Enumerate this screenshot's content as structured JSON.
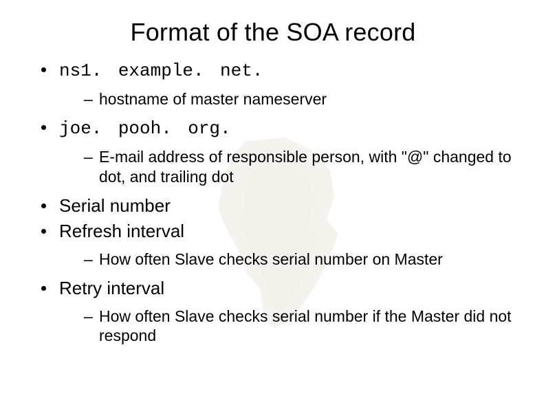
{
  "title": "Format of the SOA record",
  "items": [
    {
      "text": "ns1. example. net.",
      "mono": true,
      "sub": "hostname of master nameserver"
    },
    {
      "text": "joe. pooh. org.",
      "mono": true,
      "sub": "E-mail address of responsible person, with \"@\" changed to dot, and trailing dot"
    },
    {
      "text": "Serial number",
      "mono": false
    },
    {
      "text": "Refresh interval",
      "mono": false,
      "sub": "How often Slave checks serial number on Master"
    },
    {
      "text": "Retry interval",
      "mono": false,
      "sub": "How often Slave checks serial number if the Master did not respond"
    }
  ]
}
